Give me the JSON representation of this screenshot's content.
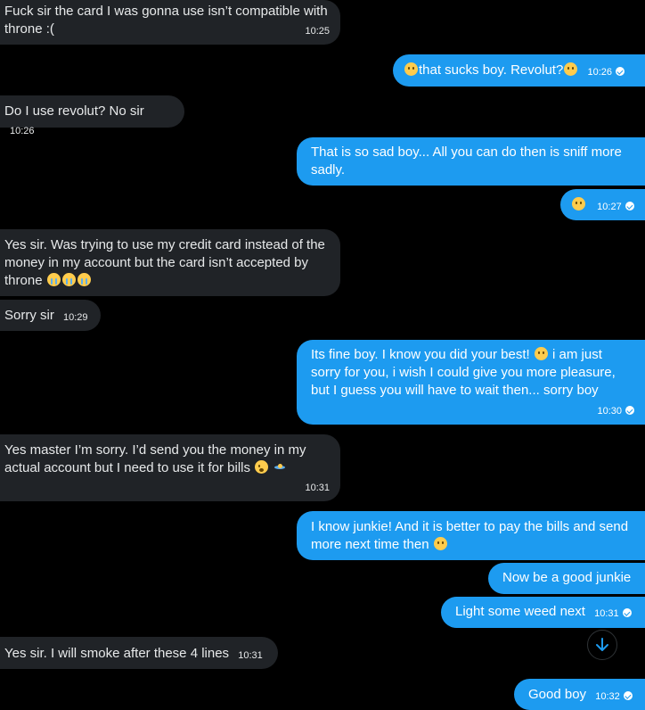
{
  "messages": [
    {
      "id": "m1",
      "dir": "in",
      "text": "Fuck sir the card I was gonna use isn’t compatible with throne :(",
      "time": "10:25"
    },
    {
      "id": "m2",
      "dir": "out",
      "text": "that sucks boy. Revolut?",
      "time": "10:26",
      "emoji_before": "smile-icon",
      "emoji_after": "smile-icon"
    },
    {
      "id": "m3",
      "dir": "in",
      "text": "Do I use revolut? No sir",
      "time": "10:26"
    },
    {
      "id": "m4",
      "dir": "out",
      "text": "That is so sad boy... All you can do then is sniff more sadly."
    },
    {
      "id": "m5",
      "dir": "out",
      "text": "",
      "time": "10:27",
      "emoji": "smile-icon"
    },
    {
      "id": "m6",
      "dir": "in",
      "text": "Yes sir. Was trying to use my credit card instead of the money in my account but the card isn’t accepted by throne",
      "emojis": [
        "crying-icon",
        "crying-icon",
        "crying-icon"
      ]
    },
    {
      "id": "m7",
      "dir": "in",
      "text": "Sorry sir",
      "time": "10:29"
    },
    {
      "id": "m8",
      "dir": "out",
      "text": "Its fine boy. I know you did your best!",
      "text2": "i am just sorry for you, i wish I could give you more pleasure, but I guess you will have to wait then... sorry boy",
      "time": "10:30"
    },
    {
      "id": "m9",
      "dir": "in",
      "text": "Yes master I’m sorry. I’d send you the money in my actual account but I need to use it for bills",
      "time": "10:31"
    },
    {
      "id": "m10",
      "dir": "out",
      "text": "I know junkie! And it is better to pay the bills and send more next time then"
    },
    {
      "id": "m11",
      "dir": "out",
      "text": "Now be a good junkie"
    },
    {
      "id": "m12",
      "dir": "out",
      "text": "Light some weed next",
      "time": "10:31"
    },
    {
      "id": "m13",
      "dir": "in",
      "text": "Yes sir. I will smoke after these 4 lines",
      "time": "10:31"
    },
    {
      "id": "m14",
      "dir": "out",
      "text": "Good boy",
      "time": "10:32"
    }
  ],
  "colors": {
    "background": "#000000",
    "incoming": "#202327",
    "outgoing": "#1d9bf0",
    "text": "#e7e9ea"
  },
  "controls": {
    "scroll_down_icon": "arrow-down-icon"
  }
}
